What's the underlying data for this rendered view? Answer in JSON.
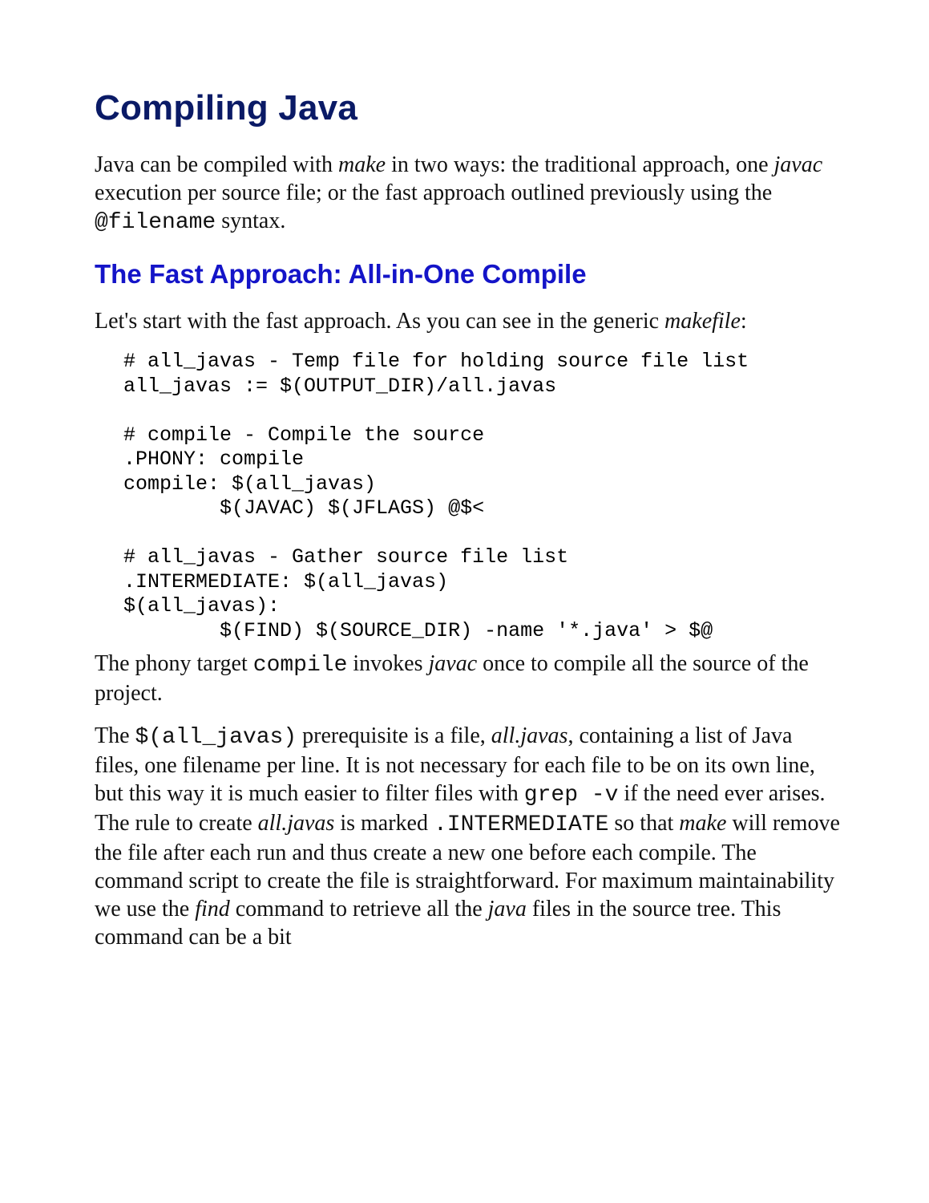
{
  "section": {
    "title": "Compiling Java",
    "intro": {
      "t1": "Java can be compiled with ",
      "i1": "make",
      "t2": " in two ways: the traditional approach, one ",
      "i2": "javac",
      "t3": " execution per source file; or the fast approach outlined previously using the ",
      "m1": "@filename",
      "t4": " syntax."
    },
    "sub1": {
      "title": "The Fast Approach: All-in-One Compile",
      "lead": {
        "t1": "Let's start with the fast approach. As you can see in the generic ",
        "i1": "makefile",
        "t2": ":"
      },
      "code": "# all_javas - Temp file for holding source file list\nall_javas := $(OUTPUT_DIR)/all.javas\n\n# compile - Compile the source\n.PHONY: compile\ncompile: $(all_javas)\n        $(JAVAC) $(JFLAGS) @$<\n\n# all_javas - Gather source file list\n.INTERMEDIATE: $(all_javas)\n$(all_javas):\n        $(FIND) $(SOURCE_DIR) -name '*.java' > $@",
      "p2": {
        "t1": "The phony target ",
        "m1": "compile",
        "t2": " invokes ",
        "i1": "javac",
        "t3": " once to compile all the source of the project."
      },
      "p3": {
        "t1": "The ",
        "m1": "$(all_javas)",
        "t2": " prerequisite is a file, ",
        "i1": "all.javas",
        "t3": ", containing a list of Java files, one filename per line. It is not necessary for each file to be on its own line, but this way it is much easier to filter files with ",
        "m2": "grep -v",
        "t4": " if the need ever arises. The rule to create ",
        "i2": "all.javas",
        "t5": " is marked ",
        "m3": ".INTERMEDIATE",
        "t6": " so that ",
        "i3": "make",
        "t7": " will remove the file after each run and thus create a new one before each compile. The command script to create the file is straightforward. For maximum maintainability we use the ",
        "i4": "find",
        "t8": " command to retrieve all the ",
        "i5": "java",
        "t9": " files in the source tree. This command can be a bit"
      }
    }
  }
}
